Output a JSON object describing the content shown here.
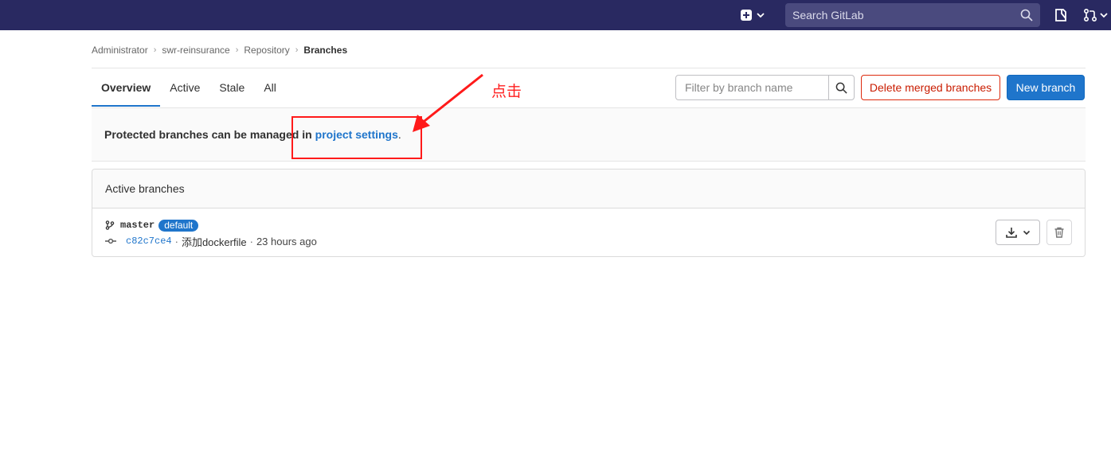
{
  "navbar": {
    "search_placeholder": "Search GitLab",
    "icons": [
      "plus-square-icon",
      "chevron-down-icon",
      "search-icon",
      "todo-icon",
      "merge-request-icon"
    ],
    "background": "#292961"
  },
  "breadcrumb": {
    "items": [
      "Administrator",
      "swr-reinsurance",
      "Repository"
    ],
    "current": "Branches"
  },
  "tabs": [
    {
      "label": "Overview",
      "active": true
    },
    {
      "label": "Active",
      "active": false
    },
    {
      "label": "Stale",
      "active": false
    },
    {
      "label": "All",
      "active": false
    }
  ],
  "filter": {
    "placeholder": "Filter by branch name"
  },
  "buttons": {
    "delete_merged": "Delete merged branches",
    "new_branch": "New branch"
  },
  "banner": {
    "text": "Protected branches can be managed in",
    "link": "project settings",
    "suffix": "."
  },
  "annotation": {
    "text": "点击",
    "color": "#ff1a1a"
  },
  "active_branches": {
    "title": "Active branches",
    "items": [
      {
        "name": "master",
        "badge": "default",
        "sha": "c82c7ce4",
        "message": "添加dockerfile",
        "time": "23 hours ago"
      }
    ]
  },
  "colors": {
    "accent": "#1f75cb",
    "danger": "#dd2b0e"
  }
}
